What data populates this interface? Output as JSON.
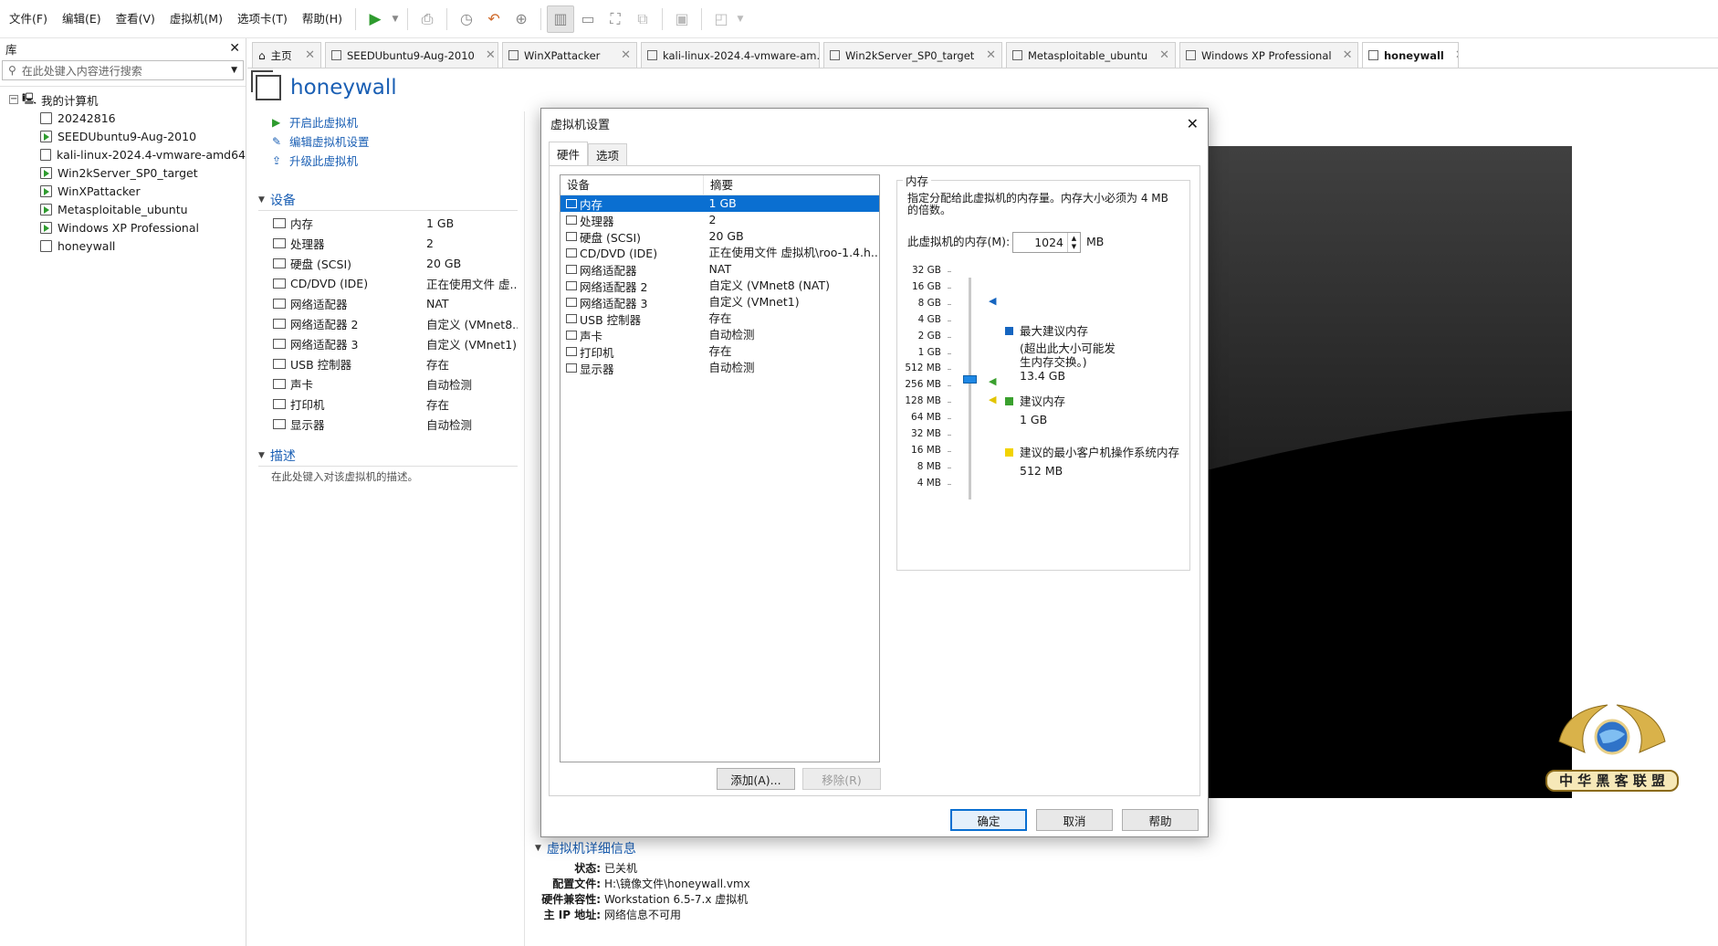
{
  "menu": [
    "文件(F)",
    "编辑(E)",
    "查看(V)",
    "虚拟机(M)",
    "选项卡(T)",
    "帮助(H)"
  ],
  "library": {
    "title": "库",
    "search_placeholder": "在此处键入内容进行搜索",
    "root": "我的计算机",
    "vms": [
      {
        "name": "20242816",
        "running": false
      },
      {
        "name": "SEEDUbuntu9-Aug-2010",
        "running": true
      },
      {
        "name": "kali-linux-2024.4-vmware-amd64",
        "running": false
      },
      {
        "name": "Win2kServer_SP0_target",
        "running": true
      },
      {
        "name": "WinXPattacker",
        "running": true
      },
      {
        "name": "Metasploitable_ubuntu",
        "running": true
      },
      {
        "name": "Windows XP Professional",
        "running": true
      },
      {
        "name": "honeywall",
        "running": false
      }
    ]
  },
  "tabs": [
    {
      "label": "主页",
      "active": false
    },
    {
      "label": "SEEDUbuntu9-Aug-2010",
      "active": false
    },
    {
      "label": "WinXPattacker",
      "active": false
    },
    {
      "label": "kali-linux-2024.4-vmware-am...",
      "active": false
    },
    {
      "label": "Win2kServer_SP0_target",
      "active": false
    },
    {
      "label": "Metasploitable_ubuntu",
      "active": false
    },
    {
      "label": "Windows XP Professional",
      "active": false
    },
    {
      "label": "honeywall",
      "active": true
    }
  ],
  "vm": {
    "title": "honeywall",
    "actions": [
      "开启此虚拟机",
      "编辑虚拟机设置",
      "升级此虚拟机"
    ],
    "devices_header": "设备",
    "devices": [
      {
        "name": "内存",
        "value": "1 GB"
      },
      {
        "name": "处理器",
        "value": "2"
      },
      {
        "name": "硬盘 (SCSI)",
        "value": "20 GB"
      },
      {
        "name": "CD/DVD (IDE)",
        "value": "正在使用文件 虚..."
      },
      {
        "name": "网络适配器",
        "value": "NAT"
      },
      {
        "name": "网络适配器 2",
        "value": "自定义 (VMnet8..."
      },
      {
        "name": "网络适配器 3",
        "value": "自定义 (VMnet1)"
      },
      {
        "name": "USB 控制器",
        "value": "存在"
      },
      {
        "name": "声卡",
        "value": "自动检测"
      },
      {
        "name": "打印机",
        "value": "存在"
      },
      {
        "name": "显示器",
        "value": "自动检测"
      }
    ],
    "desc_header": "描述",
    "desc_placeholder": "在此处键入对该虚拟机的描述。",
    "details_header": "虚拟机详细信息",
    "details": [
      {
        "k": "状态:",
        "v": "已关机"
      },
      {
        "k": "配置文件:",
        "v": "H:\\镜像文件\\honeywall.vmx"
      },
      {
        "k": "硬件兼容性:",
        "v": "Workstation 6.5-7.x 虚拟机"
      },
      {
        "k": "主 IP 地址:",
        "v": "网络信息不可用"
      }
    ]
  },
  "dialog": {
    "title": "虚拟机设置",
    "tabs": [
      "硬件",
      "选项"
    ],
    "col_device": "设备",
    "col_summary": "摘要",
    "hardware": [
      {
        "name": "内存",
        "summary": "1 GB",
        "selected": true
      },
      {
        "name": "处理器",
        "summary": "2",
        "selected": false
      },
      {
        "name": "硬盘 (SCSI)",
        "summary": "20 GB",
        "selected": false
      },
      {
        "name": "CD/DVD (IDE)",
        "summary": "正在使用文件 虚拟机\\roo-1.4.h...",
        "selected": false
      },
      {
        "name": "网络适配器",
        "summary": "NAT",
        "selected": false
      },
      {
        "name": "网络适配器 2",
        "summary": "自定义 (VMnet8 (NAT)",
        "selected": false
      },
      {
        "name": "网络适配器 3",
        "summary": "自定义 (VMnet1)",
        "selected": false
      },
      {
        "name": "USB 控制器",
        "summary": "存在",
        "selected": false
      },
      {
        "name": "声卡",
        "summary": "自动检测",
        "selected": false
      },
      {
        "name": "打印机",
        "summary": "存在",
        "selected": false
      },
      {
        "name": "显示器",
        "summary": "自动检测",
        "selected": false
      }
    ],
    "add_label": "添加(A)...",
    "remove_label": "移除(R)",
    "memory": {
      "group_title": "内存",
      "description": "指定分配给此虚拟机的内存量。内存大小必须为 4 MB 的倍数。",
      "field_label": "此虚拟机的内存(M):",
      "value": "1024",
      "unit": "MB",
      "scale": [
        "32 GB",
        "16 GB",
        "8 GB",
        "4 GB",
        "2 GB",
        "1 GB",
        "512 MB",
        "256 MB",
        "128 MB",
        "64 MB",
        "32 MB",
        "16 MB",
        "8 MB",
        "4 MB"
      ],
      "slider_value": "1 GB",
      "legend": {
        "max_title": "最大建议内存",
        "max_note": "(超出此大小可能发生内存交换。)",
        "max_value": "13.4 GB",
        "rec_title": "建议内存",
        "rec_value": "1 GB",
        "min_title": "建议的最小客户机操作系统内存",
        "min_value": "512 MB"
      },
      "colors": {
        "max": "#1565c0",
        "rec": "#3aa02e",
        "min": "#f2d300"
      }
    },
    "ok_label": "确定",
    "cancel_label": "取消",
    "help_label": "帮助"
  },
  "watermark_text": "中 华 黑 客 联 盟"
}
